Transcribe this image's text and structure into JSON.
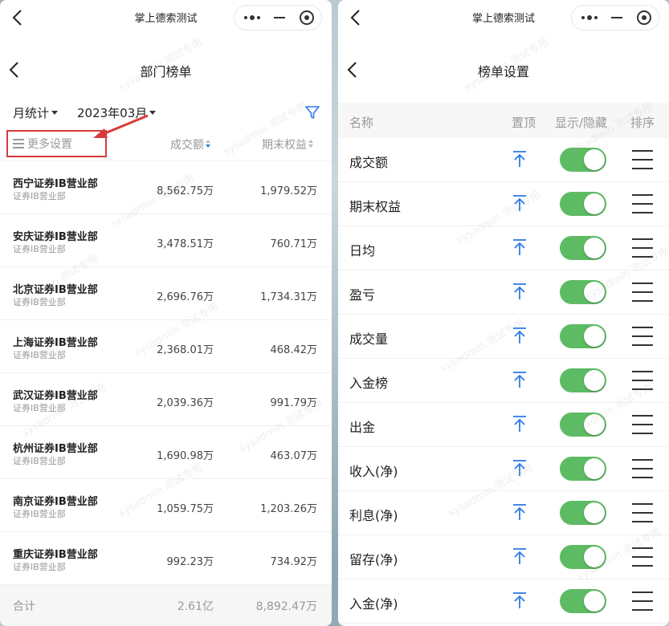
{
  "left": {
    "window_title": "掌上德索测试",
    "page_title": "部门榜单",
    "filters": {
      "period": "月统计",
      "month": "2023年03月"
    },
    "more_settings_label": "更多设置",
    "columns": [
      "成交额",
      "期末权益"
    ],
    "rows": [
      {
        "name": "西宁证券IB营业部",
        "sub": "证券IB营业部",
        "amount": "8,562.75万",
        "equity": "1,979.52万"
      },
      {
        "name": "安庆证券IB营业部",
        "sub": "证券IB营业部",
        "amount": "3,478.51万",
        "equity": "760.71万"
      },
      {
        "name": "北京证券IB营业部",
        "sub": "证券IB营业部",
        "amount": "2,696.76万",
        "equity": "1,734.31万"
      },
      {
        "name": "上海证券IB营业部",
        "sub": "证券IB营业部",
        "amount": "2,368.01万",
        "equity": "468.42万"
      },
      {
        "name": "武汉证券IB营业部",
        "sub": "证券IB营业部",
        "amount": "2,039.36万",
        "equity": "991.79万"
      },
      {
        "name": "杭州证券IB营业部",
        "sub": "证券IB营业部",
        "amount": "1,690.98万",
        "equity": "463.07万"
      },
      {
        "name": "南京证券IB营业部",
        "sub": "证券IB营业部",
        "amount": "1,059.75万",
        "equity": "1,203.26万"
      },
      {
        "name": "重庆证券IB营业部",
        "sub": "证券IB营业部",
        "amount": "992.23万",
        "equity": "734.92万"
      }
    ],
    "total": {
      "label": "合计",
      "amount": "2.61亿",
      "equity": "8,892.47万"
    }
  },
  "right": {
    "window_title": "掌上德索测试",
    "page_title": "榜单设置",
    "headers": {
      "name": "名称",
      "pin": "置顶",
      "show": "显示/隐藏",
      "sort": "排序"
    },
    "items": [
      {
        "name": "成交额",
        "visible": true
      },
      {
        "name": "期末权益",
        "visible": true
      },
      {
        "name": "日均",
        "visible": true
      },
      {
        "name": "盈亏",
        "visible": true
      },
      {
        "name": "成交量",
        "visible": true
      },
      {
        "name": "入金榜",
        "visible": true
      },
      {
        "name": "出金",
        "visible": true
      },
      {
        "name": "收入(净)",
        "visible": true
      },
      {
        "name": "利息(净)",
        "visible": true
      },
      {
        "name": "留存(净)",
        "visible": true
      },
      {
        "name": "入金(净)",
        "visible": true
      }
    ]
  },
  "watermark": "sysadmin 测试专用",
  "colors": {
    "toggle_on": "#5dbb63",
    "accent": "#2d7be5",
    "annotation": "#d83a3a"
  },
  "icons": [
    "back-chevron-icon",
    "more-dots-icon",
    "minimize-icon",
    "close-target-icon",
    "filter-funnel-icon",
    "list-icon",
    "pin-to-top-icon",
    "drag-handle-icon"
  ]
}
